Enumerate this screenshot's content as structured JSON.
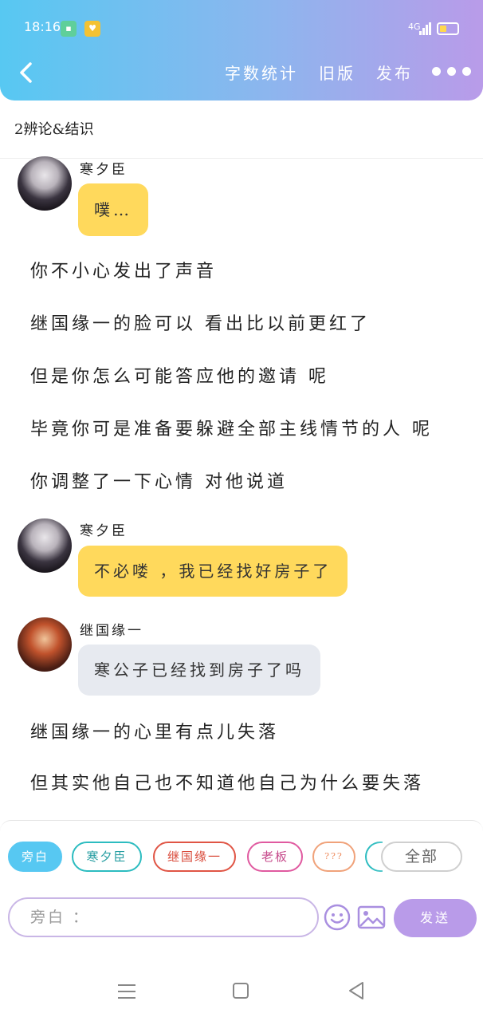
{
  "status_bar": {
    "time": "18:16",
    "network": "4G"
  },
  "header": {
    "word_count_label": "字数统计",
    "old_version_label": "旧版",
    "publish_label": "发布"
  },
  "chapter_title": "2辨论&结识",
  "messages": [
    {
      "type": "dialogue",
      "speaker": "寒夕臣",
      "text": "噗…"
    },
    {
      "type": "narration",
      "text": "你不小心发出了声音"
    },
    {
      "type": "narration",
      "text": "继国缘一的脸可以 看出比以前更红了"
    },
    {
      "type": "narration",
      "text": "但是你怎么可能答应他的邀请 呢"
    },
    {
      "type": "narration",
      "text": "毕竟你可是准备要躲避全部主线情节的人 呢"
    },
    {
      "type": "narration",
      "text": "你调整了一下心情 对他说道"
    },
    {
      "type": "dialogue",
      "speaker": "寒夕臣",
      "text": "不必喽 ，我已经找好房子了"
    },
    {
      "type": "dialogue",
      "speaker": "继国缘一",
      "text": "寒公子已经找到房子了吗"
    },
    {
      "type": "narration",
      "text": "继国缘一的心里有点儿失落"
    },
    {
      "type": "narration",
      "text": "但其实他自己也不知道他自己为什么要失落"
    }
  ],
  "role_chips": [
    {
      "label": "旁白",
      "active": true
    },
    {
      "label": "寒夕臣"
    },
    {
      "label": "继国缘一"
    },
    {
      "label": "老板"
    },
    {
      "label": "???"
    }
  ],
  "all_roles_label": "全部",
  "composer": {
    "placeholder": "旁白 ：",
    "send_label": "发送"
  },
  "colors": {
    "header_gradient_start": "#57c8f2",
    "header_gradient_end": "#b99be9",
    "bubble_self": "#ffd95c",
    "bubble_other": "#e7eaf0",
    "send_button": "#b99be9"
  }
}
